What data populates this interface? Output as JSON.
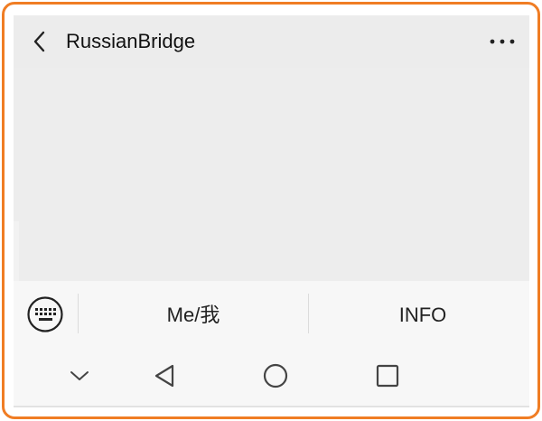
{
  "header": {
    "title": "RussianBridge",
    "back_icon": "chevron-left-icon",
    "more_icon": "more-horizontal-icon"
  },
  "bottom_menu": {
    "keyboard_icon": "keyboard-icon",
    "items": [
      {
        "label": "Me/我"
      },
      {
        "label": "INFO"
      }
    ]
  },
  "system_nav": {
    "icons": [
      "hide-keyboard-chevron-down-icon",
      "back-triangle-icon",
      "home-circle-icon",
      "recents-square-icon"
    ]
  },
  "colors": {
    "frame_border": "#f07d24",
    "topbar_bg": "#ececec",
    "content_bg": "#ededed",
    "menu_bg": "#f7f7f7",
    "text": "#111111"
  }
}
